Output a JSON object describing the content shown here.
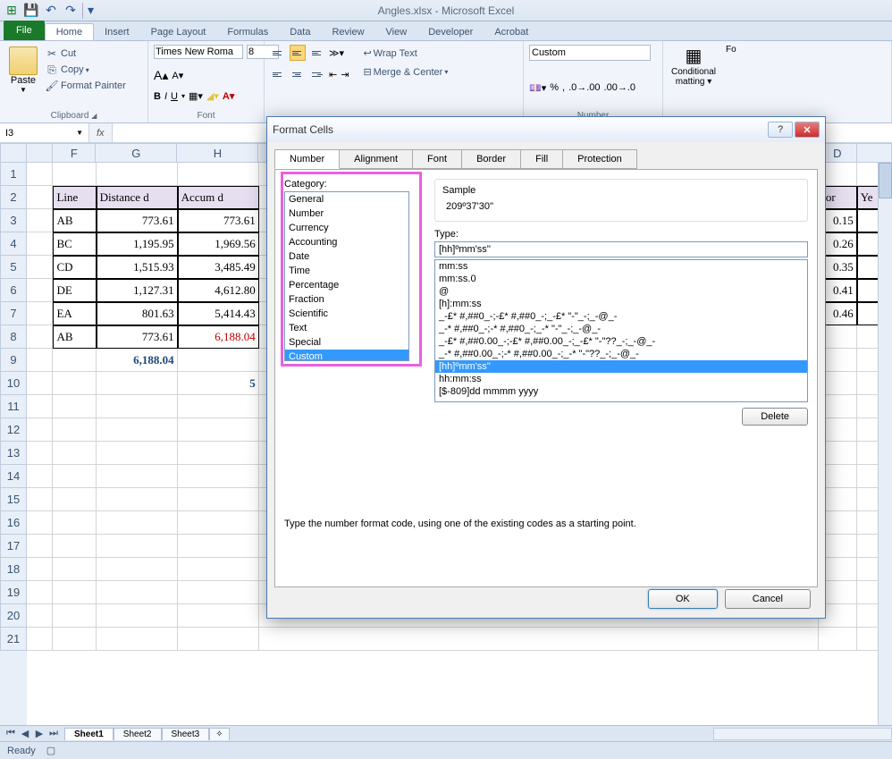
{
  "app": {
    "title": "Angles.xlsx - Microsoft Excel"
  },
  "qat": {
    "save": "💾",
    "undo": "↶",
    "redo": "↷"
  },
  "tabs": {
    "file": "File",
    "items": [
      "Home",
      "Insert",
      "Page Layout",
      "Formulas",
      "Data",
      "Review",
      "View",
      "Developer",
      "Acrobat"
    ],
    "active": "Home"
  },
  "ribbon": {
    "clipboard": {
      "label": "Clipboard",
      "paste": "Paste",
      "cut": "Cut",
      "copy": "Copy",
      "painter": "Format Painter"
    },
    "font": {
      "label": "Font",
      "name": "Times New Roma",
      "size": "8"
    },
    "alignment": {
      "wrap": "Wrap Text",
      "merge": "Merge & Center"
    },
    "number": {
      "label": "Number",
      "format": "Custom"
    },
    "styles": {
      "cond": "Conditional Formatting",
      "fmt": "Fo"
    }
  },
  "namebox": "I3",
  "columns": [
    "F",
    "G",
    "H"
  ],
  "columnsRight": [
    "D"
  ],
  "headersRow": [
    "Line",
    "Distance d",
    "Accum d"
  ],
  "headersRight": [
    "ror",
    "Ye"
  ],
  "rows": [
    {
      "n": 1,
      "cells": [
        "",
        "",
        ""
      ]
    },
    {
      "n": 2,
      "cells": [
        "Line",
        "Distance d",
        "Accum d"
      ],
      "hdr": true
    },
    {
      "n": 3,
      "cells": [
        "AB",
        "773.61",
        "773.61"
      ],
      "right": [
        "0.15",
        "-"
      ]
    },
    {
      "n": 4,
      "cells": [
        "BC",
        "1,195.95",
        "1,969.56"
      ],
      "right": [
        "0.26",
        "-"
      ]
    },
    {
      "n": 5,
      "cells": [
        "CD",
        "1,515.93",
        "3,485.49"
      ],
      "right": [
        "0.35",
        "-"
      ]
    },
    {
      "n": 6,
      "cells": [
        "DE",
        "1,127.31",
        "4,612.80"
      ],
      "right": [
        "0.41",
        "-"
      ]
    },
    {
      "n": 7,
      "cells": [
        "EA",
        "801.63",
        "5,414.43"
      ],
      "right": [
        "0.46",
        "-"
      ]
    },
    {
      "n": 8,
      "cells": [
        "AB",
        "773.61",
        "6,188.04"
      ],
      "red": true
    },
    {
      "n": 9,
      "cells": [
        "",
        "6,188.04",
        ""
      ],
      "blue": true
    },
    {
      "n": 10,
      "cells": [
        "",
        "",
        "5"
      ],
      "blue": true
    }
  ],
  "emptyRows": [
    11,
    12,
    13,
    14,
    15,
    16,
    17,
    18,
    19,
    20,
    21
  ],
  "sheetTabs": {
    "items": [
      "Sheet1",
      "Sheet2",
      "Sheet3"
    ],
    "active": "Sheet1"
  },
  "status": "Ready",
  "dialog": {
    "title": "Format Cells",
    "tabs": [
      "Number",
      "Alignment",
      "Font",
      "Border",
      "Fill",
      "Protection"
    ],
    "activeTab": "Number",
    "categoryLabel": "Category:",
    "categories": [
      "General",
      "Number",
      "Currency",
      "Accounting",
      "Date",
      "Time",
      "Percentage",
      "Fraction",
      "Scientific",
      "Text",
      "Special",
      "Custom"
    ],
    "selectedCategory": "Custom",
    "sampleLabel": "Sample",
    "sampleValue": "209º37'30''",
    "typeLabel": "Type:",
    "typeValue": "[hh]ºmm'ss''",
    "typeList": [
      "mm:ss",
      "mm:ss.0",
      "@",
      "[h]:mm:ss",
      "_-£* #,##0_-;-£* #,##0_-;_-£* \"-\"_-;_-@_-",
      "_-* #,##0_-;-* #,##0_-;_-* \"-\"_-;_-@_-",
      "_-£* #,##0.00_-;-£* #,##0.00_-;_-£* \"-\"??_-;_-@_-",
      "_-* #,##0.00_-;-* #,##0.00_-;_-* \"-\"??_-;_-@_-",
      "[hh]ºmm'ss''",
      "hh:mm:ss",
      "[$-809]dd mmmm yyyy"
    ],
    "selectedType": "[hh]ºmm'ss''",
    "deleteBtn": "Delete",
    "hint": "Type the number format code, using one of the existing codes as a starting point.",
    "ok": "OK",
    "cancel": "Cancel"
  }
}
